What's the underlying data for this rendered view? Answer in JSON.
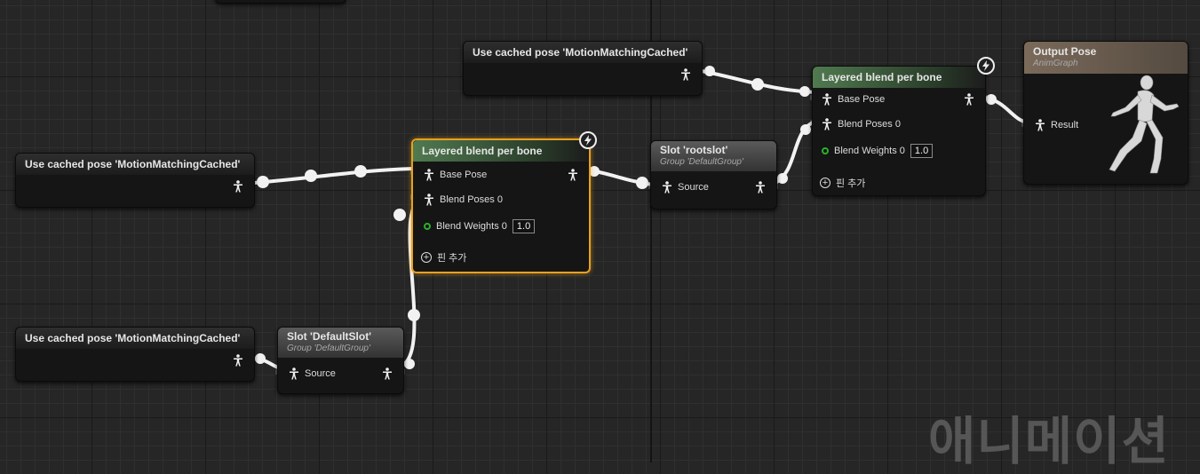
{
  "graph": {
    "watermark": "애니메이션"
  },
  "nodes": {
    "cache_top": {
      "title": "Use cached pose 'MotionMatchingCached'"
    },
    "cache_mid": {
      "title": "Use cached pose 'MotionMatchingCached'"
    },
    "cache_bottom": {
      "title": "Use cached pose 'MotionMatchingCached'"
    },
    "blend_left": {
      "title": "Layered blend per bone",
      "base_pose": "Base Pose",
      "blend_poses": "Blend Poses 0",
      "blend_weights": "Blend Weights 0",
      "blend_weights_value": "1.0",
      "add_pin": "핀 추가"
    },
    "blend_right": {
      "title": "Layered blend per bone",
      "base_pose": "Base Pose",
      "blend_poses": "Blend Poses 0",
      "blend_weights": "Blend Weights 0",
      "blend_weights_value": "1.0",
      "add_pin": "핀 추가"
    },
    "slot_default": {
      "title": "Slot 'DefaultSlot'",
      "group": "Group 'DefaultGroup'",
      "source": "Source"
    },
    "slot_root": {
      "title": "Slot 'rootslot'",
      "group": "Group 'DefaultGroup'",
      "source": "Source"
    },
    "output_pose": {
      "title": "Output Pose",
      "subtitle": "AnimGraph",
      "result": "Result"
    }
  },
  "colors": {
    "wire": "#f2f2f2",
    "selection": "#e8a020",
    "blend_header": "#507a50",
    "weight_pin": "#2bb02b",
    "output_header": "#7a6a5a"
  },
  "icons": {
    "pose_pin": "pose-pin-icon",
    "fast_path": "lightning-icon",
    "add": "add-pin-icon",
    "mannequin": "mannequin-icon"
  }
}
